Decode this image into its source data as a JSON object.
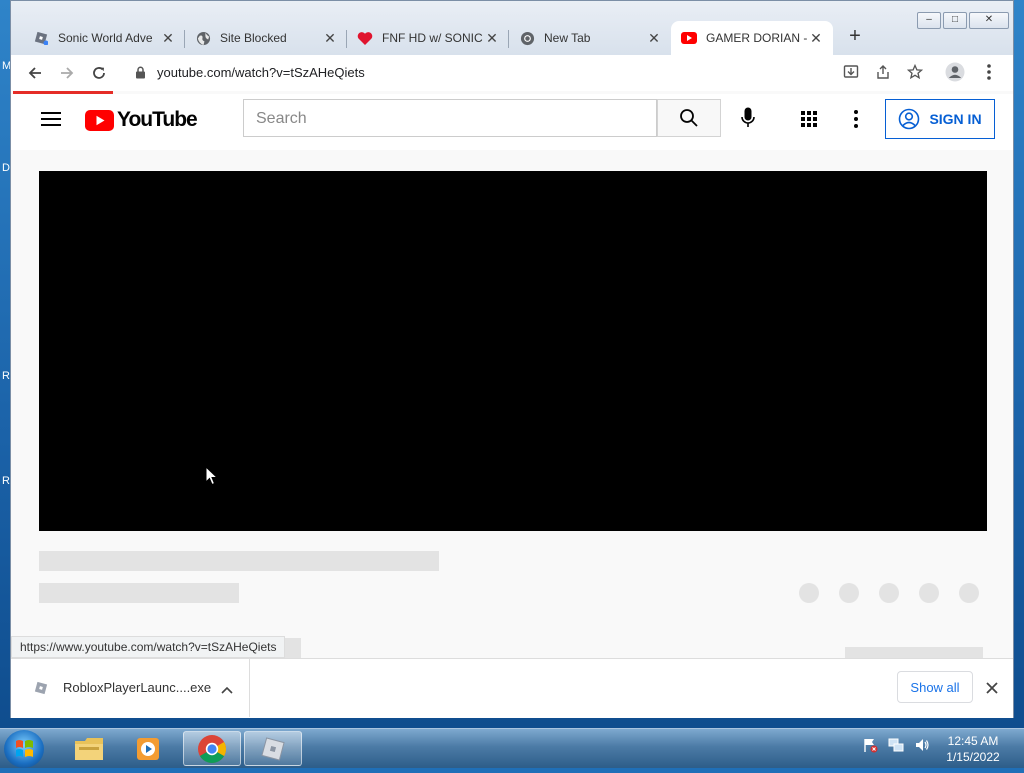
{
  "desktop": {
    "side_letters": [
      "M",
      "D",
      "R",
      "R"
    ]
  },
  "browser": {
    "tabs": [
      {
        "title": "Sonic World Adve",
        "icon": "roblox-icon",
        "active": false
      },
      {
        "title": "Site Blocked",
        "icon": "globe-icon",
        "active": false
      },
      {
        "title": "FNF HD w/ SONIC",
        "icon": "heart-icon",
        "active": false
      },
      {
        "title": "New Tab",
        "icon": "chrome-icon",
        "active": false
      },
      {
        "title": "GAMER DORIAN -",
        "icon": "youtube-icon",
        "active": true
      }
    ],
    "url": "youtube.com/watch?v=tSzAHeQiets",
    "window_controls": [
      "minimize",
      "maximize",
      "close"
    ]
  },
  "youtube": {
    "logo_text": "YouTube",
    "search_placeholder": "Search",
    "sign_in_label": "SIGN IN",
    "brand_red": "#FF0000",
    "accent_blue": "#065FD4"
  },
  "status_bar": {
    "url": "https://www.youtube.com/watch?v=tSzAHeQiets"
  },
  "downloads": {
    "file_name": "RobloxPlayerLaunc....exe",
    "show_all_label": "Show all"
  },
  "taskbar": {
    "apps": [
      "windows-explorer",
      "media-player",
      "chrome",
      "roblox"
    ],
    "time": "12:45 AM",
    "date": "1/15/2022"
  }
}
